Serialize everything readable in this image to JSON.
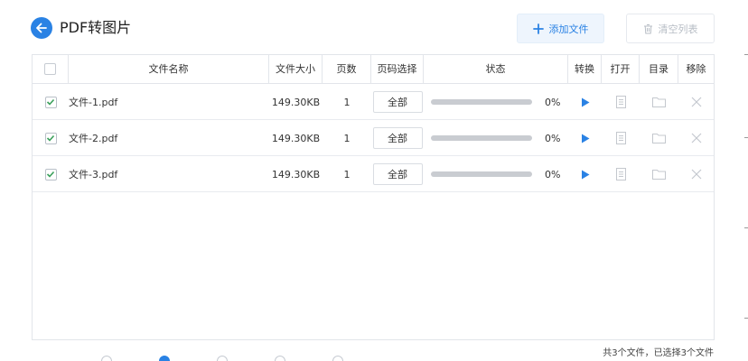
{
  "header": {
    "title": "PDF转图片",
    "add_label": "添加文件",
    "clear_label": "清空列表"
  },
  "table": {
    "columns": [
      "文件名称",
      "文件大小",
      "页数",
      "页码选择",
      "状态",
      "转换",
      "打开",
      "目录",
      "移除"
    ],
    "rows": [
      {
        "name": "文件-1.pdf",
        "size": "149.30KB",
        "pages": "1",
        "range": "全部",
        "progress": 0,
        "status": "0%"
      },
      {
        "name": "文件-2.pdf",
        "size": "149.30KB",
        "pages": "1",
        "range": "全部",
        "progress": 0,
        "status": "0%"
      },
      {
        "name": "文件-3.pdf",
        "size": "149.30KB",
        "pages": "1",
        "range": "全部",
        "progress": 0,
        "status": "0%"
      }
    ]
  },
  "footer": {
    "summary": "共3个文件，已选择3个文件"
  },
  "colors": {
    "accent": "#2a82e4",
    "check": "#3aa05a"
  }
}
